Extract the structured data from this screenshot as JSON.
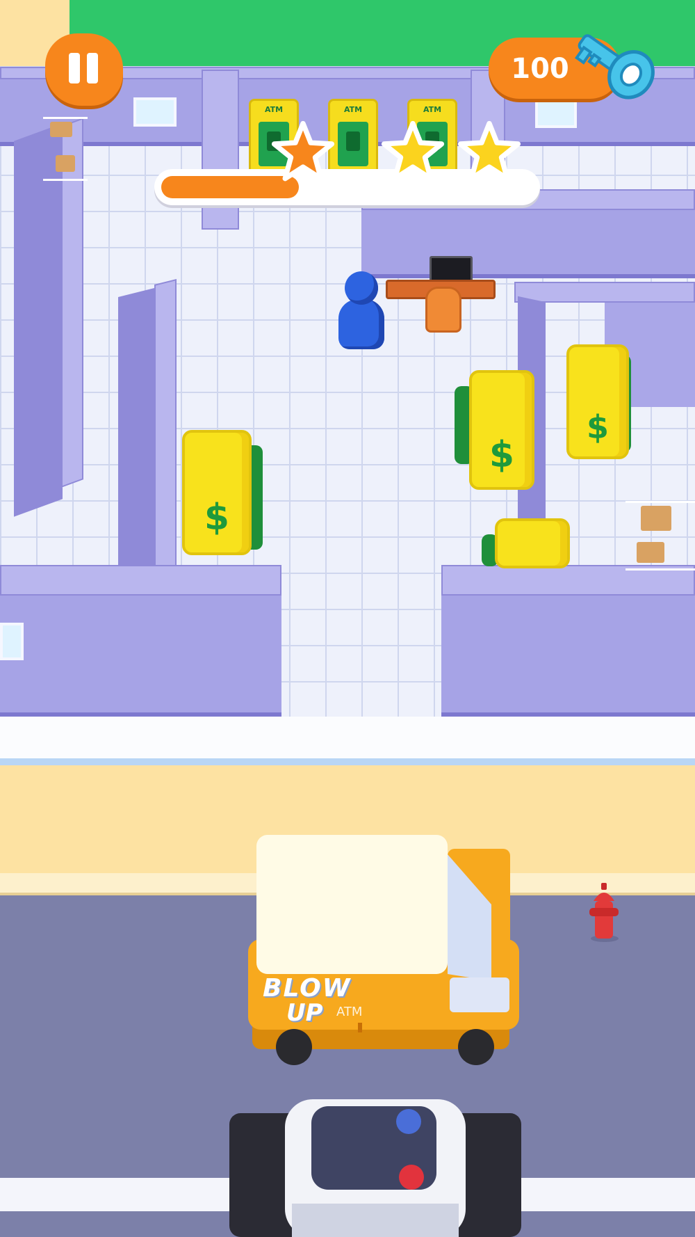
{
  "hud": {
    "pause_icon": "pause-icon",
    "key_count": "100",
    "key_icon": "key-icon",
    "level_progress": 0.37,
    "stars": [
      {
        "name": "star-1",
        "state": "earned",
        "color": "#f7861c"
      },
      {
        "name": "star-2",
        "state": "pending",
        "color": "#fbd31e"
      },
      {
        "name": "star-3",
        "state": "pending",
        "color": "#fbd31e"
      }
    ]
  },
  "scene": {
    "atms": [
      {
        "label": "ATM"
      },
      {
        "label": "ATM"
      },
      {
        "label": "ATM"
      }
    ],
    "vaults": [
      {
        "symbol": "$"
      },
      {
        "symbol": "$"
      },
      {
        "symbol": "$"
      },
      {
        "symbol": ""
      }
    ],
    "van": {
      "graffiti_line1": "BLOW",
      "graffiti_line2": "UP",
      "graffiti_small": "ATM"
    },
    "colors": {
      "accent": "#f7861c",
      "player": "#2d63e0",
      "grass": "#2fc76a",
      "wall": "#a6a3e6",
      "road": "#7c80a9"
    }
  }
}
